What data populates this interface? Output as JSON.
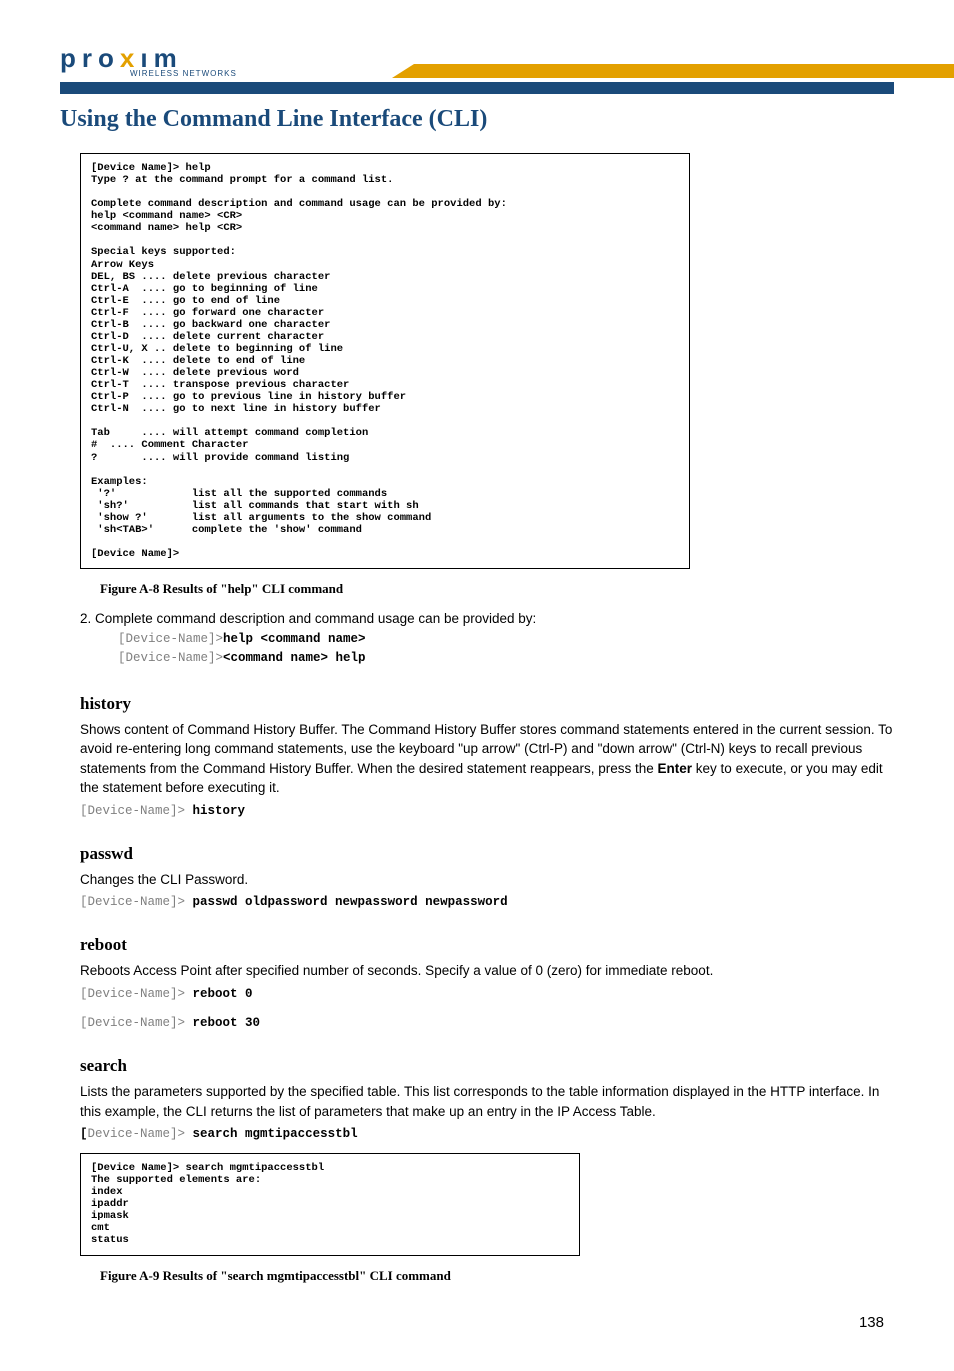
{
  "logo": {
    "brand": "pro",
    "x": "x",
    "brand2": "ım",
    "sub": "WIRELESS NETWORKS"
  },
  "title": "Using the Command Line Interface (CLI)",
  "term1": "[Device Name]> help\nType ? at the command prompt for a command list.\n\nComplete command description and command usage can be provided by:\nhelp <command name> <CR>\n<command name> help <CR>\n\nSpecial keys supported:\nArrow Keys\nDEL, BS .... delete previous character\nCtrl-A  .... go to beginning of line\nCtrl-E  .... go to end of line\nCtrl-F  .... go forward one character\nCtrl-B  .... go backward one character\nCtrl-D  .... delete current character\nCtrl-U, X .. delete to beginning of line\nCtrl-K  .... delete to end of line\nCtrl-W  .... delete previous word\nCtrl-T  .... transpose previous character\nCtrl-P  .... go to previous line in history buffer\nCtrl-N  .... go to next line in history buffer\n\nTab     .... will attempt command completion\n#  .... Comment Character\n?       .... will provide command listing\n\nExamples:\n '?'            list all the supported commands\n 'sh?'          list all commands that start with sh\n 'show ?'       list all arguments to the show command\n 'sh<TAB>'      complete the 'show' command\n\n[Device Name]>",
  "fig1": "Figure A-8    Results of \"help\" CLI command",
  "step2": "2.   Complete command description and command usage can be provided by:",
  "code1a_gray": "[Device-Name]>",
  "code1a_bold": "help <command name>",
  "code1b_gray": "[Device-Name]>",
  "code1b_bold": "<command name> help",
  "history": {
    "h": "history",
    "p": "Shows content of Command History Buffer. The Command History Buffer stores command statements entered in the current session. To avoid re-entering long command statements, use the keyboard \"up arrow\" (Ctrl-P) and \"down arrow\" (Ctrl-N) keys to recall previous statements from the Command History Buffer. When the desired statement reappears, press the ",
    "enter": "Enter",
    "p2": " key to execute, or you may edit the statement before executing it.",
    "prompt": "[Device-Name]>",
    "cmd": " history"
  },
  "passwd": {
    "h": "passwd",
    "p": "Changes the CLI Password.",
    "prompt": "[Device-Name]>",
    "cmd": " passwd oldpassword newpassword newpassword"
  },
  "reboot": {
    "h": "reboot",
    "p": "Reboots Access Point after specified number of seconds. Specify a value of 0 (zero) for immediate reboot.",
    "prompt1": "[Device-Name]>",
    "cmd1": " reboot 0",
    "prompt2": "[Device-Name]>",
    "cmd2": " reboot 30"
  },
  "search": {
    "h": "search",
    "p": "Lists the parameters supported by the specified table. This list corresponds to the table information displayed in the HTTP interface. In this example, the CLI returns the list of parameters that make up an entry in the IP Access Table.",
    "promptBracket": "[",
    "promptRest": "Device-Name]>",
    "cmd": " search mgmtipaccesstbl"
  },
  "term2": "[Device Name]> search mgmtipaccesstbl\nThe supported elements are:\nindex\nipaddr\nipmask\ncmt\nstatus",
  "fig2": "Figure A-9    Results of \"search mgmtipaccesstbl\" CLI command",
  "pageNum": "138"
}
